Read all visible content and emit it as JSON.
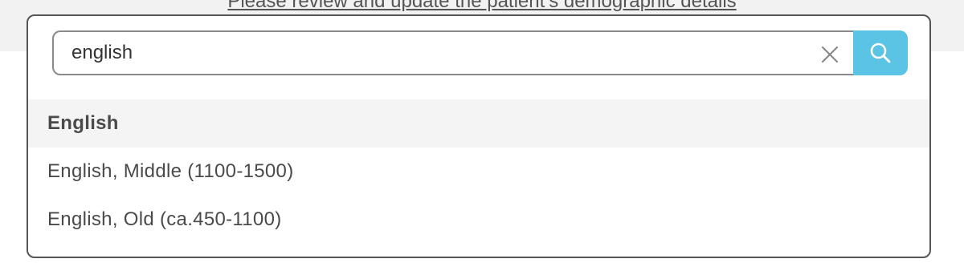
{
  "background": {
    "instruction_text": "Please review and update the patient’s demographic details"
  },
  "search": {
    "value": "english",
    "clear_icon": "close-icon",
    "search_icon": "search-icon"
  },
  "results": [
    {
      "label": "English",
      "highlighted": true
    },
    {
      "label": "English, Middle (1100-1500)",
      "highlighted": false
    },
    {
      "label": "English, Old (ca.450-1100)",
      "highlighted": false
    }
  ],
  "colors": {
    "accent": "#5bc3e3",
    "highlight_row": "#f4f4f4",
    "border": "#555555"
  }
}
